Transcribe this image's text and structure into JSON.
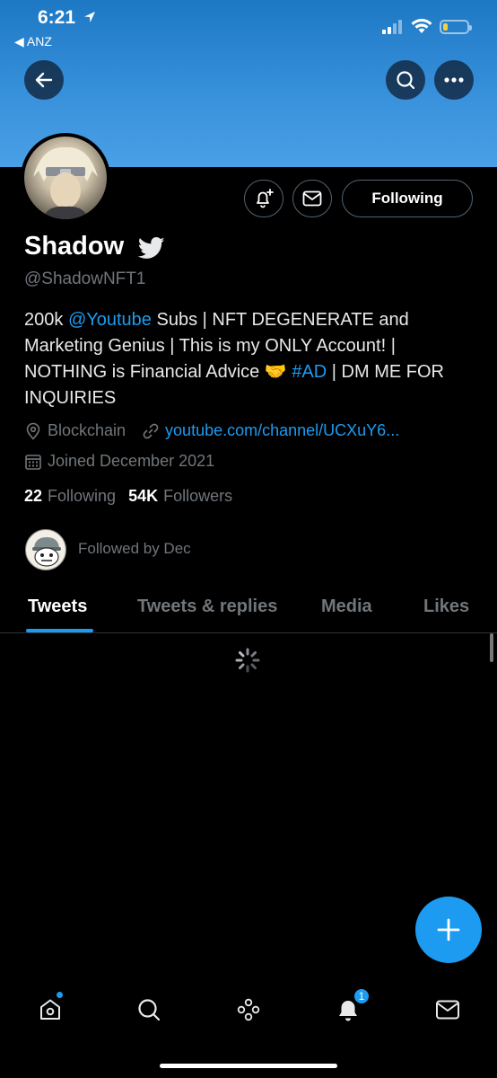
{
  "status_bar": {
    "time": "6:21",
    "back_app": "◀ ANZ"
  },
  "profile": {
    "display_name": "Shadow",
    "handle": "@ShadowNFT1",
    "bio": {
      "part1": "200k ",
      "mention": "@Youtube",
      "part2": " Subs | NFT DEGENERATE and Marketing Genius | This is my ONLY Account! | NOTHING is Financial Advice 🤝 ",
      "hashtag": "#AD",
      "part3": " | DM ME FOR INQUIRIES"
    },
    "location": "Blockchain",
    "website": "youtube.com/channel/UCXuY6...",
    "joined": "Joined December 2021",
    "following_count": "22",
    "following_label": "Following",
    "followers_count": "54K",
    "followers_label": "Followers",
    "followed_by": "Followed by Dec"
  },
  "actions": {
    "following_button": "Following"
  },
  "tabs": [
    {
      "label": "Tweets",
      "active": true
    },
    {
      "label": "Tweets & replies",
      "active": false
    },
    {
      "label": "Media",
      "active": false
    },
    {
      "label": "Likes",
      "active": false
    }
  ],
  "bottom_nav": {
    "items": [
      "home-icon",
      "search-icon",
      "spaces-icon",
      "bell-icon",
      "mail-icon"
    ],
    "notification_badge": "1"
  },
  "colors": {
    "accent": "#1d9bf0",
    "banner": "#3a92dc",
    "background": "#000000",
    "muted_text": "#71767b"
  }
}
